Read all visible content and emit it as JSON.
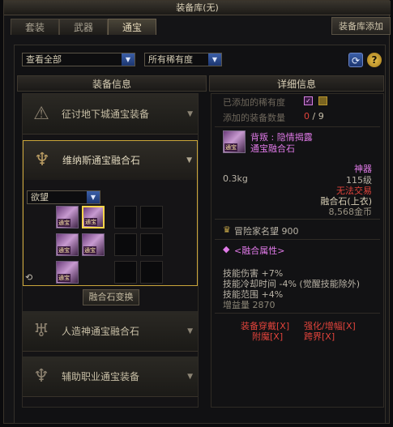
{
  "window": {
    "title": "装备库(无)"
  },
  "tabs": [
    {
      "label": "套装",
      "active": false
    },
    {
      "label": "武器",
      "active": false
    },
    {
      "label": "通宝",
      "active": true
    }
  ],
  "add_button": "装备库添加",
  "filters": {
    "view": "查看全部",
    "rarity": "所有稀有度"
  },
  "left_header": "装备信息",
  "right_header": "详细信息",
  "categories": [
    {
      "label": "征讨地下城通宝装备"
    },
    {
      "label": "维纳斯通宝融合石",
      "expanded": true
    },
    {
      "label": "人造神通宝融合石"
    },
    {
      "label": "辅助职业通宝装备"
    }
  ],
  "sub_filter": "欲望",
  "item_tag": "通宝",
  "fuse_button": "融合石变换",
  "details": {
    "rarity_label": "已添加的稀有度",
    "count_label": "添加的装备数量",
    "count_current": "0",
    "count_sep": "/",
    "count_max": "9",
    "item_name_line1": "背叛 : 隐情揭露",
    "item_name_line2": "通宝融合石",
    "rarity": "神器",
    "weight": "0.3kg",
    "level": "115级",
    "trade": "无法交易",
    "type": "融合石(上衣)",
    "price": "8,568金币",
    "fame_label": "冒险家名望",
    "fame_value": "900",
    "attr_title": "<融合属性>",
    "attrs": [
      "技能伤害 +7%",
      "技能冷却时间 -4% (觉醒技能除外)",
      "技能范围 +4%",
      "增益量 2870"
    ],
    "links_row1": [
      "装备穿戴[X]",
      "强化/增幅[X]"
    ],
    "links_row2": [
      "附魔[X]",
      "跨界[X]"
    ]
  },
  "colors": {
    "gold": "#caa53a",
    "purple_name": "#e07ae8",
    "red": "#e0433b",
    "rarity": "#e07ae8"
  }
}
